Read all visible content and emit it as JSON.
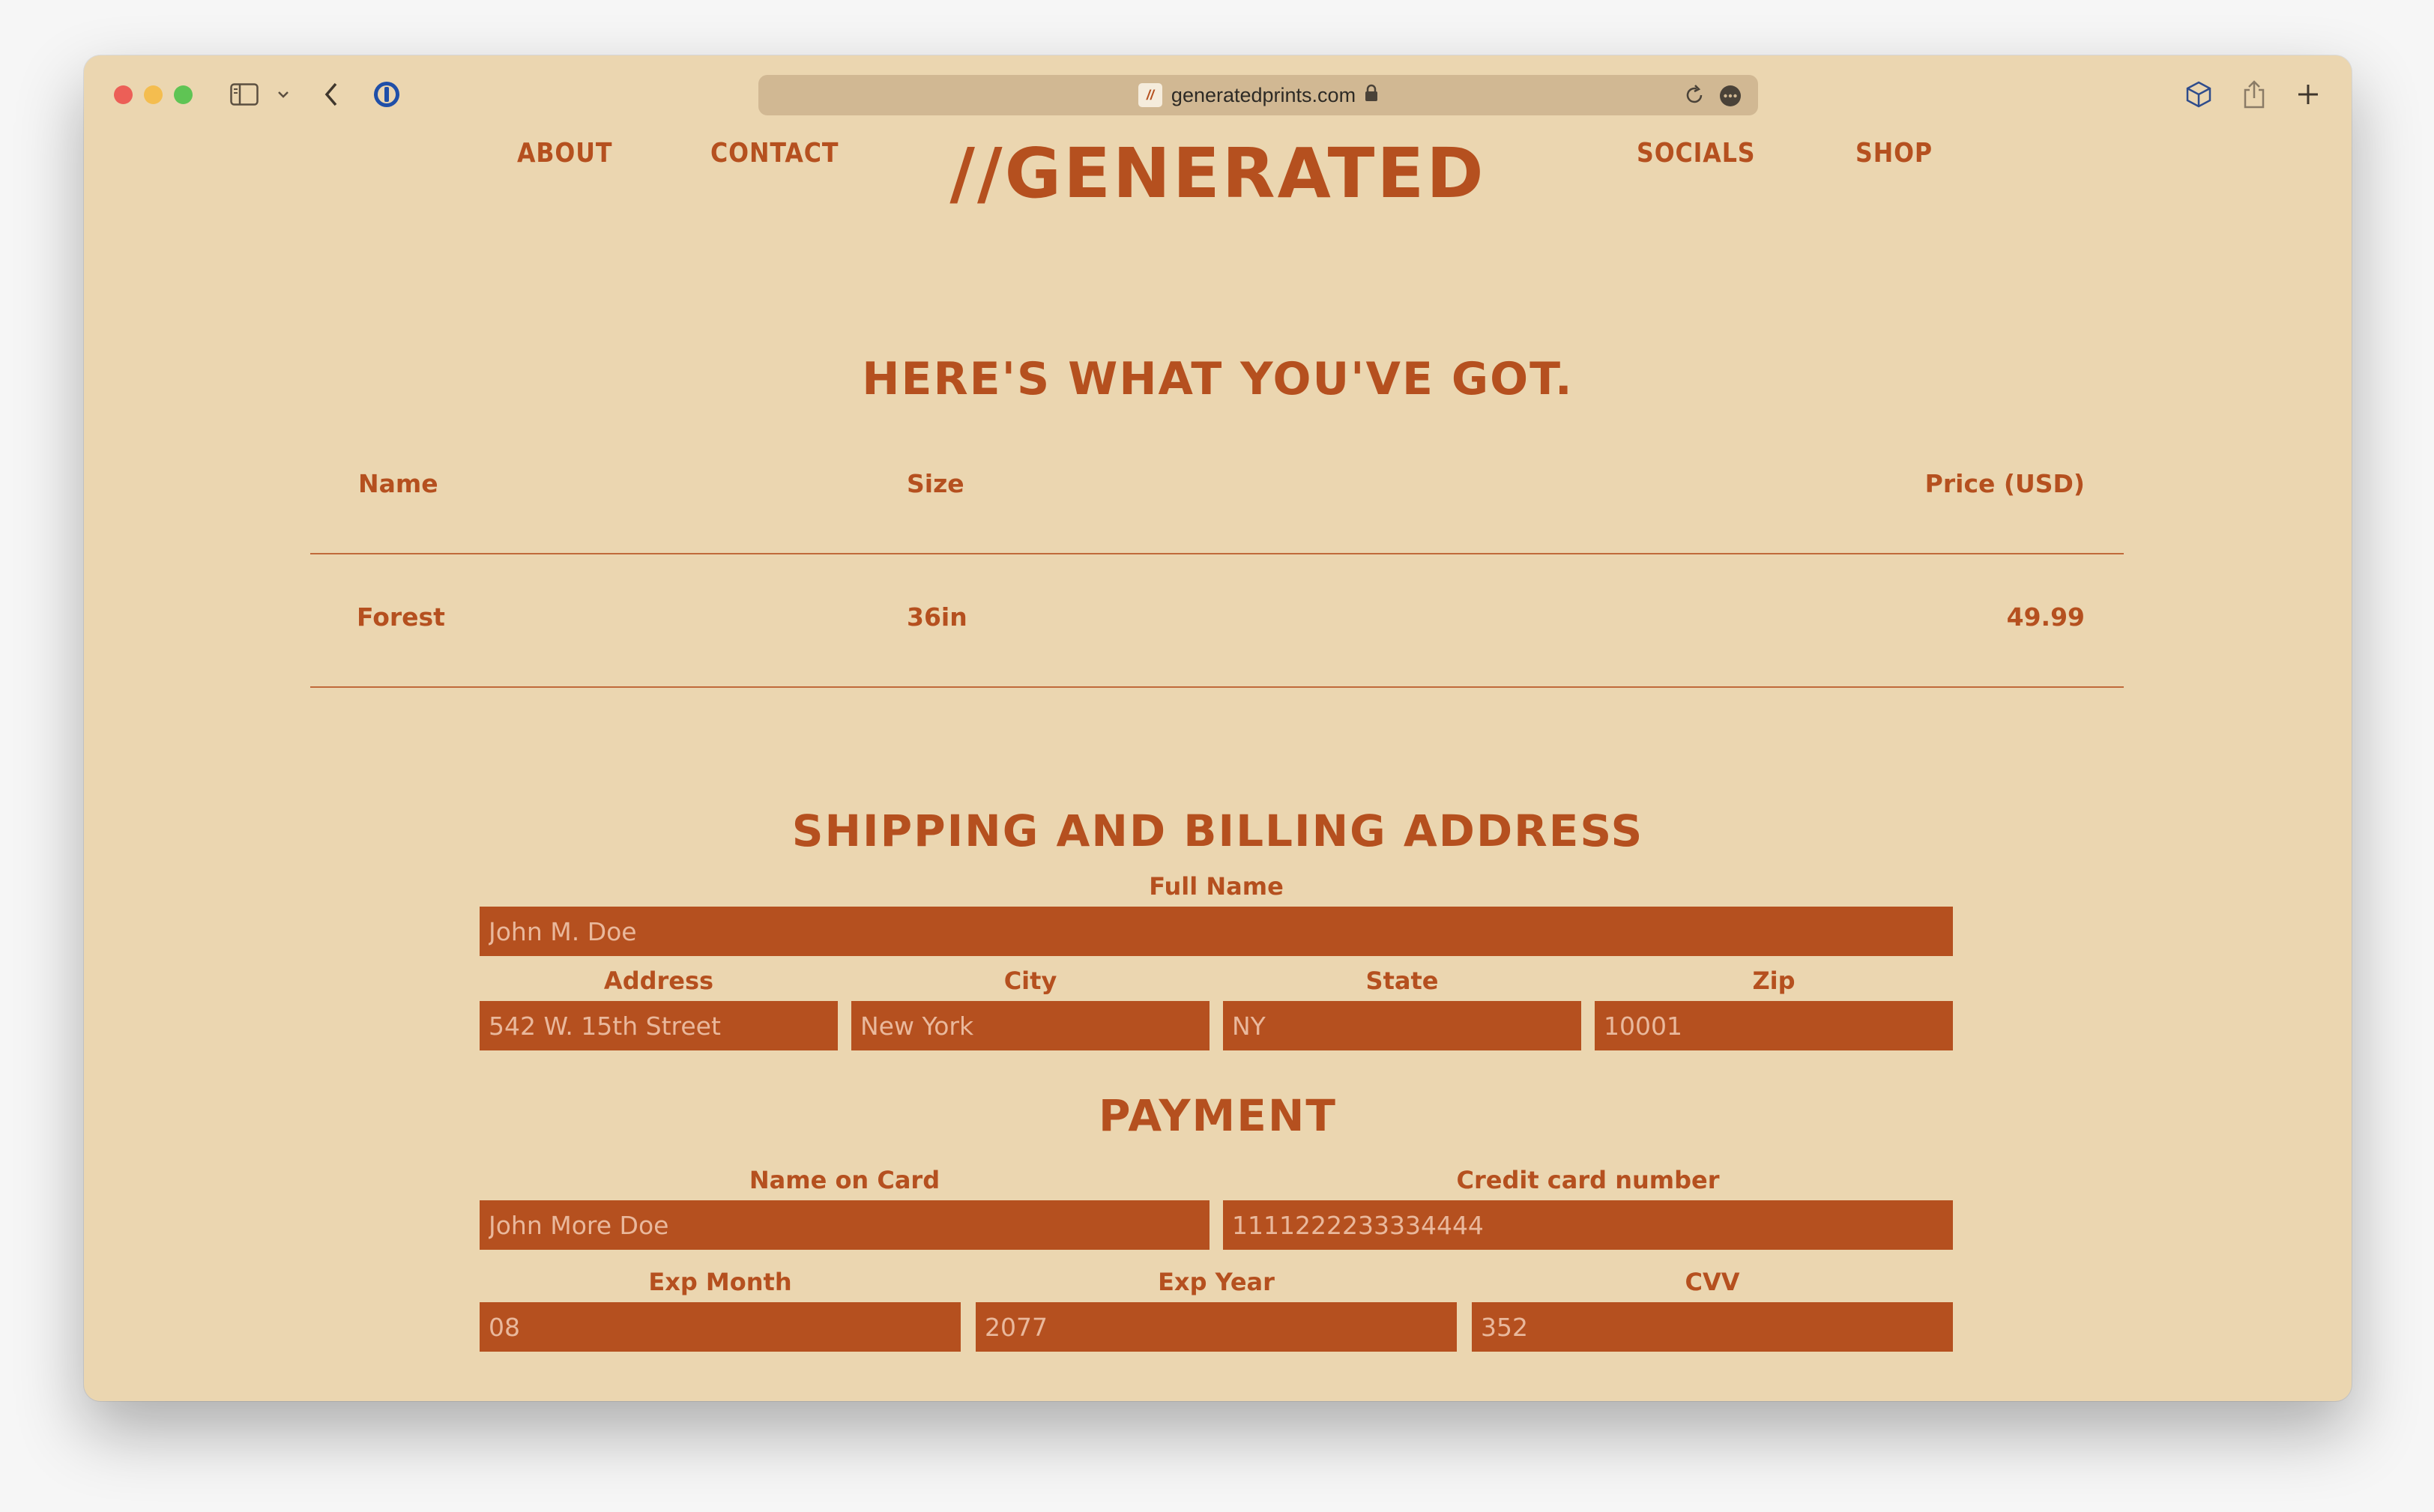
{
  "browser": {
    "url": "generatedprints.com",
    "favicon_text": "//"
  },
  "nav": {
    "about": "ABOUT",
    "contact": "CONTACT",
    "logo": "//GENERATED",
    "socials": "SOCIALS",
    "shop": "SHOP"
  },
  "cart": {
    "title": "HERE'S WHAT YOU'VE GOT.",
    "headers": {
      "name": "Name",
      "size": "Size",
      "price": "Price (USD)"
    },
    "rows": [
      {
        "name": "Forest",
        "size": "36in",
        "price": "49.99"
      }
    ]
  },
  "shipping": {
    "title": "SHIPPING AND BILLING ADDRESS",
    "full_name_label": "Full Name",
    "full_name_placeholder": "John M. Doe",
    "address_label": "Address",
    "address_placeholder": "542 W. 15th Street",
    "city_label": "City",
    "city_placeholder": "New York",
    "state_label": "State",
    "state_placeholder": "NY",
    "zip_label": "Zip",
    "zip_placeholder": "10001"
  },
  "payment": {
    "title": "PAYMENT",
    "name_on_card_label": "Name on Card",
    "name_on_card_placeholder": "John More Doe",
    "card_number_label": "Credit card number",
    "card_number_placeholder": "1111222233334444",
    "exp_month_label": "Exp Month",
    "exp_month_placeholder": "08",
    "exp_year_label": "Exp Year",
    "exp_year_placeholder": "2077",
    "cvv_label": "CVV",
    "cvv_placeholder": "352"
  },
  "colors": {
    "background": "#ebd6b0",
    "accent": "#b5501f",
    "field_text": "#e9b89c"
  }
}
